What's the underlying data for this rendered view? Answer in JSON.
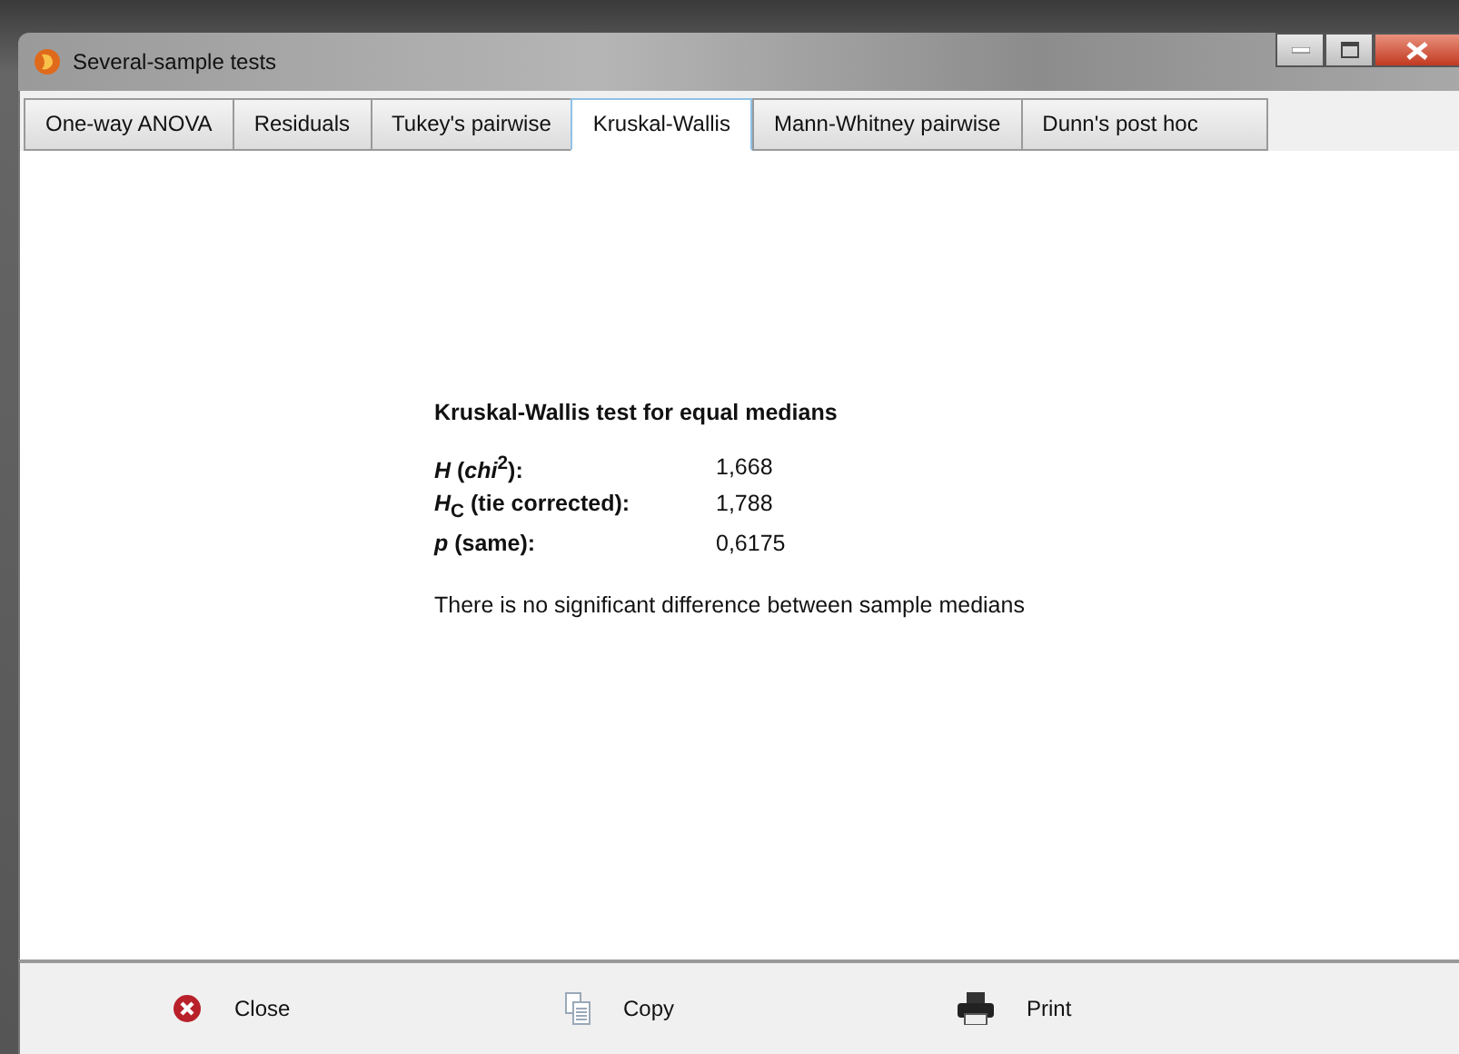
{
  "window": {
    "title": "Several-sample tests"
  },
  "tabs": [
    {
      "label": "One-way ANOVA",
      "selected": false
    },
    {
      "label": "Residuals",
      "selected": false
    },
    {
      "label": "Tukey's pairwise",
      "selected": false
    },
    {
      "label": "Kruskal-Wallis",
      "selected": true
    },
    {
      "label": "Mann-Whitney pairwise",
      "selected": false
    },
    {
      "label": "Dunn's post hoc",
      "selected": false
    }
  ],
  "report": {
    "heading": "Kruskal-Wallis test for equal medians",
    "rows": [
      {
        "label": "*H* (*chi*$^{2}$):",
        "value": "1,668"
      },
      {
        "label": "*H*$_{C}$ (tie corrected):",
        "value": "1,788"
      },
      {
        "label": "*p* (same):",
        "value": "0,6175"
      }
    ],
    "conclusion": "There is no significant difference between sample medians"
  },
  "buttons": [
    {
      "kind": "close",
      "label": "Close"
    },
    {
      "kind": "copy",
      "label": "Copy"
    },
    {
      "kind": "print",
      "label": "Print"
    }
  ]
}
